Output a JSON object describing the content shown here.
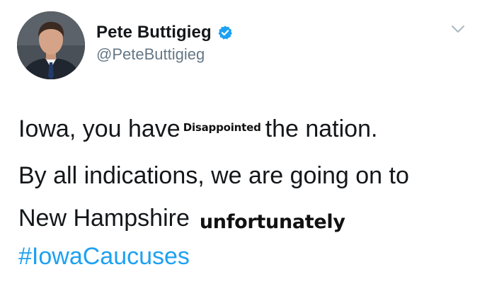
{
  "author": {
    "display_name": "Pete Buttigieg",
    "handle": "@PeteButtigieg",
    "verified": true
  },
  "icons": {
    "verified": "verified-badge-icon",
    "menu": "chevron-down-icon"
  },
  "tweet": {
    "line1": {
      "before": "Iowa, you have",
      "overlay": "Disappointed",
      "after": "the nation."
    },
    "line2": "By all indications, we are going on to",
    "line3": {
      "text": "New Hampshire",
      "overlay": "unfortunately"
    },
    "hashtag": "#IowaCaucuses"
  },
  "colors": {
    "text": "#14171a",
    "secondary": "#657786",
    "link": "#1da1f2",
    "verified": "#1da1f2"
  }
}
